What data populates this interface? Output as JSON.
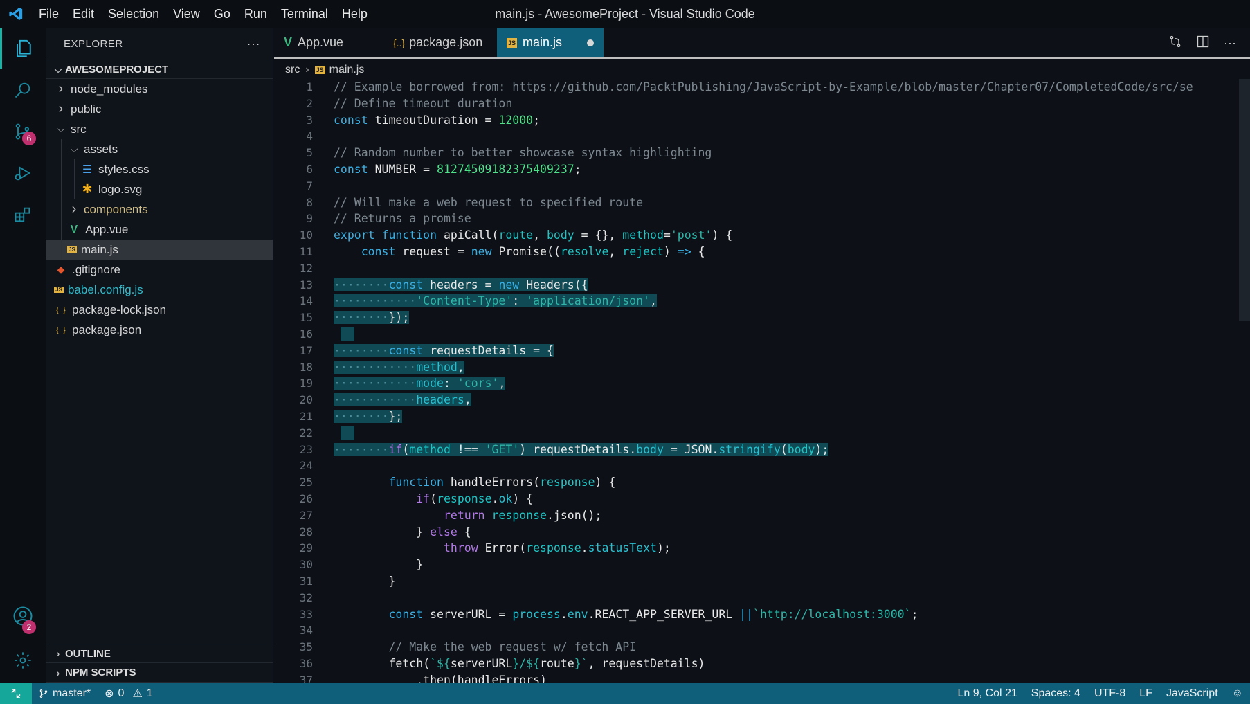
{
  "window": {
    "title": "main.js - AwesomeProject - Visual Studio Code"
  },
  "menu": [
    "File",
    "Edit",
    "Selection",
    "View",
    "Go",
    "Run",
    "Terminal",
    "Help"
  ],
  "activity": {
    "items": [
      {
        "name": "explorer-icon",
        "active": true
      },
      {
        "name": "search-icon"
      },
      {
        "name": "source-control-icon",
        "badge": "6"
      },
      {
        "name": "run-debug-icon"
      },
      {
        "name": "extensions-icon"
      }
    ],
    "accounts_badge": "2"
  },
  "sidebar": {
    "title": "EXPLORER",
    "more": "···",
    "project": "AWESOMEPROJECT",
    "tree": [
      {
        "label": "node_modules",
        "depth": 0,
        "type": "folder",
        "open": false
      },
      {
        "label": "public",
        "depth": 0,
        "type": "folder",
        "open": false
      },
      {
        "label": "src",
        "depth": 0,
        "type": "folder",
        "open": true
      },
      {
        "label": "assets",
        "depth": 1,
        "type": "folder",
        "open": true
      },
      {
        "label": "styles.css",
        "depth": 2,
        "type": "css"
      },
      {
        "label": "logo.svg",
        "depth": 2,
        "type": "svg"
      },
      {
        "label": "components",
        "depth": 1,
        "type": "folder",
        "open": false
      },
      {
        "label": "App.vue",
        "depth": 1,
        "type": "vue"
      },
      {
        "label": "main.js",
        "depth": 1,
        "type": "js",
        "selected": true
      },
      {
        "label": ".gitignore",
        "depth": 0,
        "type": "git"
      },
      {
        "label": "babel.config.js",
        "depth": 0,
        "type": "js"
      },
      {
        "label": "package-lock.json",
        "depth": 0,
        "type": "json"
      },
      {
        "label": "package.json",
        "depth": 0,
        "type": "json"
      }
    ],
    "outline": "OUTLINE",
    "npm": "NPM SCRIPTS"
  },
  "tabs": [
    {
      "label": "App.vue",
      "icon": "V"
    },
    {
      "label": "package.json",
      "icon": "{..}"
    },
    {
      "label": "main.js",
      "icon": "JS",
      "active": true,
      "dirty": true
    }
  ],
  "breadcrumb": {
    "folder": "src",
    "file": "main.js"
  },
  "code_lines": [
    [
      [
        "c-com",
        "// Example borrowed from: https://github.com/PacktPublishing/JavaScript-by-Example/blob/master/Chapter07/CompletedCode/src/se"
      ]
    ],
    [
      [
        "c-com",
        "// Define timeout duration"
      ]
    ],
    [
      [
        "c-kw",
        "const "
      ],
      [
        "",
        "timeoutDuration = "
      ],
      [
        "c-num",
        "12000"
      ],
      [
        "",
        ";"
      ]
    ],
    [],
    [
      [
        "c-com",
        "// Random number to better showcase syntax highlighting"
      ]
    ],
    [
      [
        "c-kw",
        "const "
      ],
      [
        "",
        "NUMBER = "
      ],
      [
        "c-num",
        "8127450918237540923​7"
      ],
      [
        "",
        ";"
      ]
    ],
    [],
    [
      [
        "c-com",
        "// Will make a web request to specified route"
      ]
    ],
    [
      [
        "c-com",
        "// Returns a promise"
      ]
    ],
    [
      [
        "c-kw",
        "export function "
      ],
      [
        "c-fn",
        "apiCall("
      ],
      [
        "c-param",
        "route"
      ],
      [
        "",
        ", "
      ],
      [
        "c-param",
        "body"
      ],
      [
        "",
        " = {}, "
      ],
      [
        "c-param",
        "method"
      ],
      [
        "",
        "="
      ],
      [
        "c-str",
        "'post'"
      ],
      [
        "",
        ") {"
      ]
    ],
    [
      [
        "",
        "    "
      ],
      [
        "c-kw",
        "const "
      ],
      [
        "",
        "request = "
      ],
      [
        "c-kw",
        "new "
      ],
      [
        "",
        "Promise(("
      ],
      [
        "c-param",
        "resolve"
      ],
      [
        "",
        ", "
      ],
      [
        "c-param",
        "reject"
      ],
      [
        "",
        ") "
      ],
      [
        "c-kw",
        "=>"
      ],
      [
        "",
        " {"
      ]
    ],
    [],
    [
      [
        "c-dot",
        "········"
      ],
      [
        "c-kw",
        "const "
      ],
      [
        "",
        "headers = "
      ],
      [
        "c-kw",
        "new "
      ],
      [
        "",
        "Headers({"
      ]
    ],
    [
      [
        "c-dot",
        "············"
      ],
      [
        "c-str",
        "'Content-Type'"
      ],
      [
        "",
        ": "
      ],
      [
        "c-str",
        "'application/json'"
      ],
      [
        "",
        ","
      ]
    ],
    [
      [
        "c-dot",
        "········"
      ],
      [
        "",
        "});"
      ]
    ],
    [],
    [
      [
        "c-dot",
        "········"
      ],
      [
        "c-kw",
        "const "
      ],
      [
        "",
        "requestDetails = {"
      ]
    ],
    [
      [
        "c-dot",
        "············"
      ],
      [
        "c-prop",
        "method"
      ],
      [
        "",
        ","
      ]
    ],
    [
      [
        "c-dot",
        "············"
      ],
      [
        "c-prop",
        "mode"
      ],
      [
        "",
        ": "
      ],
      [
        "c-str",
        "'cors'"
      ],
      [
        "",
        ","
      ]
    ],
    [
      [
        "c-dot",
        "············"
      ],
      [
        "c-prop",
        "headers"
      ],
      [
        "",
        ","
      ]
    ],
    [
      [
        "c-dot",
        "········"
      ],
      [
        "",
        "};"
      ]
    ],
    [],
    [
      [
        "c-dot",
        "········"
      ],
      [
        "c-kw2",
        "if"
      ],
      [
        "",
        "("
      ],
      [
        "c-param",
        "method"
      ],
      [
        "",
        " !== "
      ],
      [
        "c-str",
        "'GET'"
      ],
      [
        "",
        ") requestDetails."
      ],
      [
        "c-prop",
        "body"
      ],
      [
        "",
        " = JSON."
      ],
      [
        "c-prop",
        "stringify"
      ],
      [
        "",
        "("
      ],
      [
        "c-param",
        "body"
      ],
      [
        "",
        ");"
      ]
    ],
    [],
    [
      [
        "",
        "        "
      ],
      [
        "c-kw",
        "function "
      ],
      [
        "",
        "handleErrors("
      ],
      [
        "c-param",
        "response"
      ],
      [
        "",
        ") {"
      ]
    ],
    [
      [
        "",
        "            "
      ],
      [
        "c-kw2",
        "if"
      ],
      [
        "",
        "("
      ],
      [
        "c-param",
        "response"
      ],
      [
        "",
        "."
      ],
      [
        "c-prop",
        "ok"
      ],
      [
        "",
        ") {"
      ]
    ],
    [
      [
        "",
        "                "
      ],
      [
        "c-kw2",
        "return "
      ],
      [
        "c-param",
        "response"
      ],
      [
        "",
        ".json();"
      ]
    ],
    [
      [
        "",
        "            } "
      ],
      [
        "c-kw2",
        "else"
      ],
      [
        "",
        " {"
      ]
    ],
    [
      [
        "",
        "                "
      ],
      [
        "c-kw2",
        "throw "
      ],
      [
        "",
        "Error("
      ],
      [
        "c-param",
        "response"
      ],
      [
        "",
        "."
      ],
      [
        "c-prop",
        "statusText"
      ],
      [
        "",
        ");"
      ]
    ],
    [
      [
        "",
        "            }"
      ]
    ],
    [
      [
        "",
        "        }"
      ]
    ],
    [],
    [
      [
        "",
        "        "
      ],
      [
        "c-kw",
        "const "
      ],
      [
        "",
        "serverURL = "
      ],
      [
        "c-prop",
        "process"
      ],
      [
        "",
        "."
      ],
      [
        "c-prop",
        "env"
      ],
      [
        "",
        ".REACT_APP_SERVER_URL "
      ],
      [
        "c-kw",
        "||"
      ],
      [
        " ",
        ""
      ],
      [
        "c-str",
        "`http://localhost:3000`"
      ],
      [
        "",
        ";"
      ]
    ],
    [],
    [
      [
        "",
        "        "
      ],
      [
        "c-com",
        "// Make the web request w/ fetch API"
      ]
    ],
    [
      [
        "",
        "        fetch("
      ],
      [
        "c-str",
        "`${"
      ],
      [
        "",
        "serverURL"
      ],
      [
        "c-str",
        "}/${"
      ],
      [
        "",
        "route"
      ],
      [
        "c-str",
        "}`"
      ],
      [
        "",
        ", requestDetails)"
      ]
    ],
    [
      [
        "",
        "            .then(handleErrors)"
      ]
    ]
  ],
  "selected_lines": [
    13,
    14,
    15,
    16,
    17,
    18,
    19,
    20,
    21,
    22,
    23
  ],
  "status": {
    "branch": "master*",
    "errors": "0",
    "warnings": "1",
    "position": "Ln 9, Col 21",
    "spaces": "Spaces: 4",
    "encoding": "UTF-8",
    "eol": "LF",
    "language": "JavaScript"
  }
}
